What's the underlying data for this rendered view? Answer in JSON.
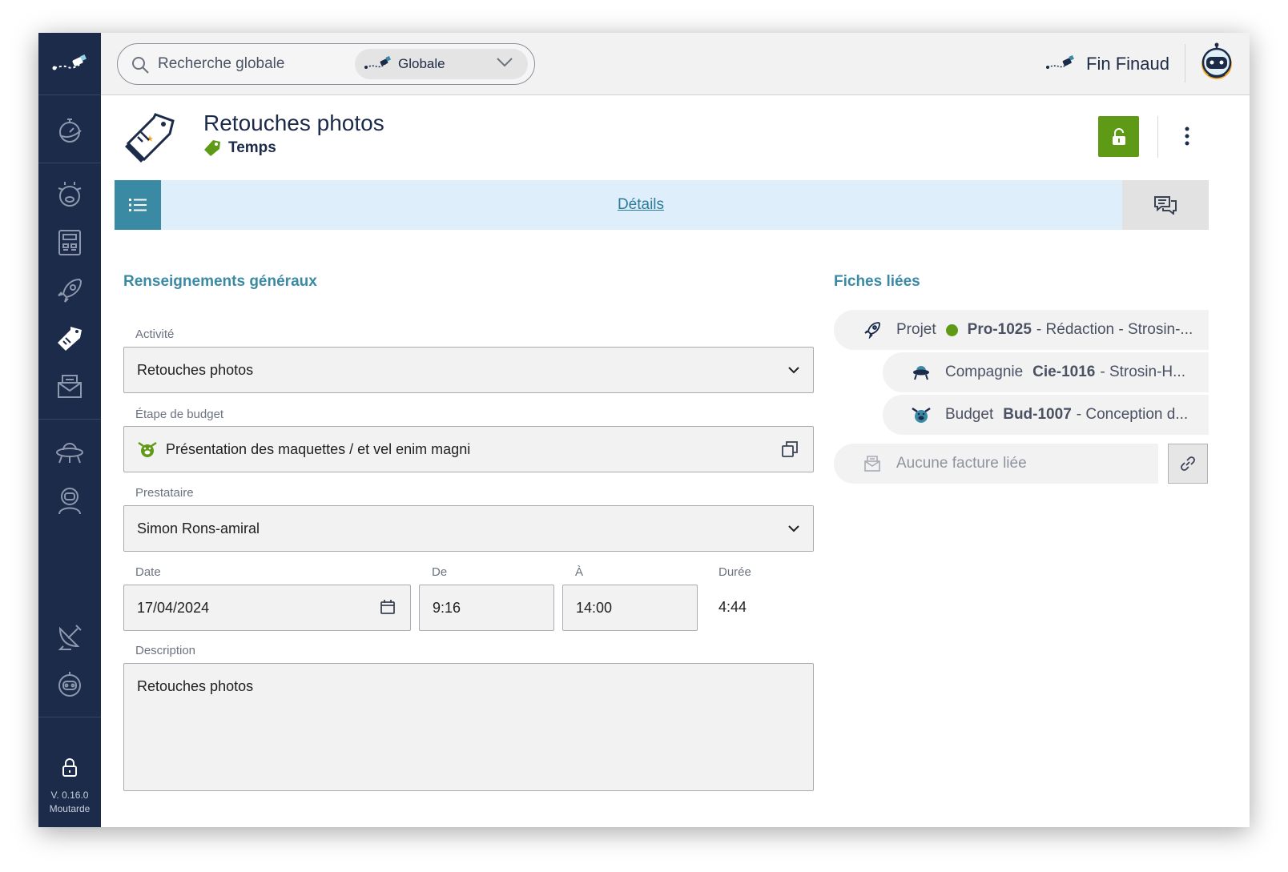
{
  "sidebar": {
    "version_line1": "V. 0.16.0",
    "version_line2": "Moutarde",
    "items": [
      {
        "name": "stopwatch",
        "active": false
      },
      {
        "name": "piggy",
        "active": false
      },
      {
        "name": "calculator",
        "active": false
      },
      {
        "name": "rocket",
        "active": false
      },
      {
        "name": "time-tag",
        "active": true
      },
      {
        "name": "invoice",
        "active": false
      },
      {
        "name": "ufo",
        "active": false
      },
      {
        "name": "astronaut",
        "active": false
      },
      {
        "name": "satellite",
        "active": false
      },
      {
        "name": "robot",
        "active": false
      }
    ]
  },
  "search": {
    "placeholder": "Recherche globale",
    "scope": "Globale"
  },
  "user": {
    "name": "Fin Finaud"
  },
  "page": {
    "title": "Retouches photos",
    "type": "Temps"
  },
  "tabs": {
    "details": "Détails"
  },
  "form": {
    "section_title": "Renseignements généraux",
    "activity": {
      "label": "Activité",
      "value": "Retouches photos"
    },
    "budget_step": {
      "label": "Étape de budget",
      "value": "Présentation des maquettes / et vel enim magni"
    },
    "provider": {
      "label": "Prestataire",
      "value": "Simon Rons-amiral"
    },
    "date": {
      "label": "Date",
      "value": "17/04/2024"
    },
    "from": {
      "label": "De",
      "value": "9:16"
    },
    "to": {
      "label": "À",
      "value": "14:00"
    },
    "duration": {
      "label": "Durée",
      "value": "4:44"
    },
    "description": {
      "label": "Description",
      "value": "Retouches photos"
    }
  },
  "linked": {
    "section_title": "Fiches liées",
    "project": {
      "type": "Projet",
      "code": "Pro-1025",
      "rest": "- Rédaction - Strosin-..."
    },
    "company": {
      "type": "Compagnie",
      "code": "Cie-1016",
      "rest": "- Strosin-H..."
    },
    "budget": {
      "type": "Budget",
      "code": "Bud-1007",
      "rest": "- Conception d..."
    },
    "no_invoice": "Aucune facture liée"
  },
  "colors": {
    "sidebar": "#1c2b4a",
    "accent": "#3b8aa4",
    "success": "#5e9a16",
    "tabs_bg": "#deeefb"
  }
}
